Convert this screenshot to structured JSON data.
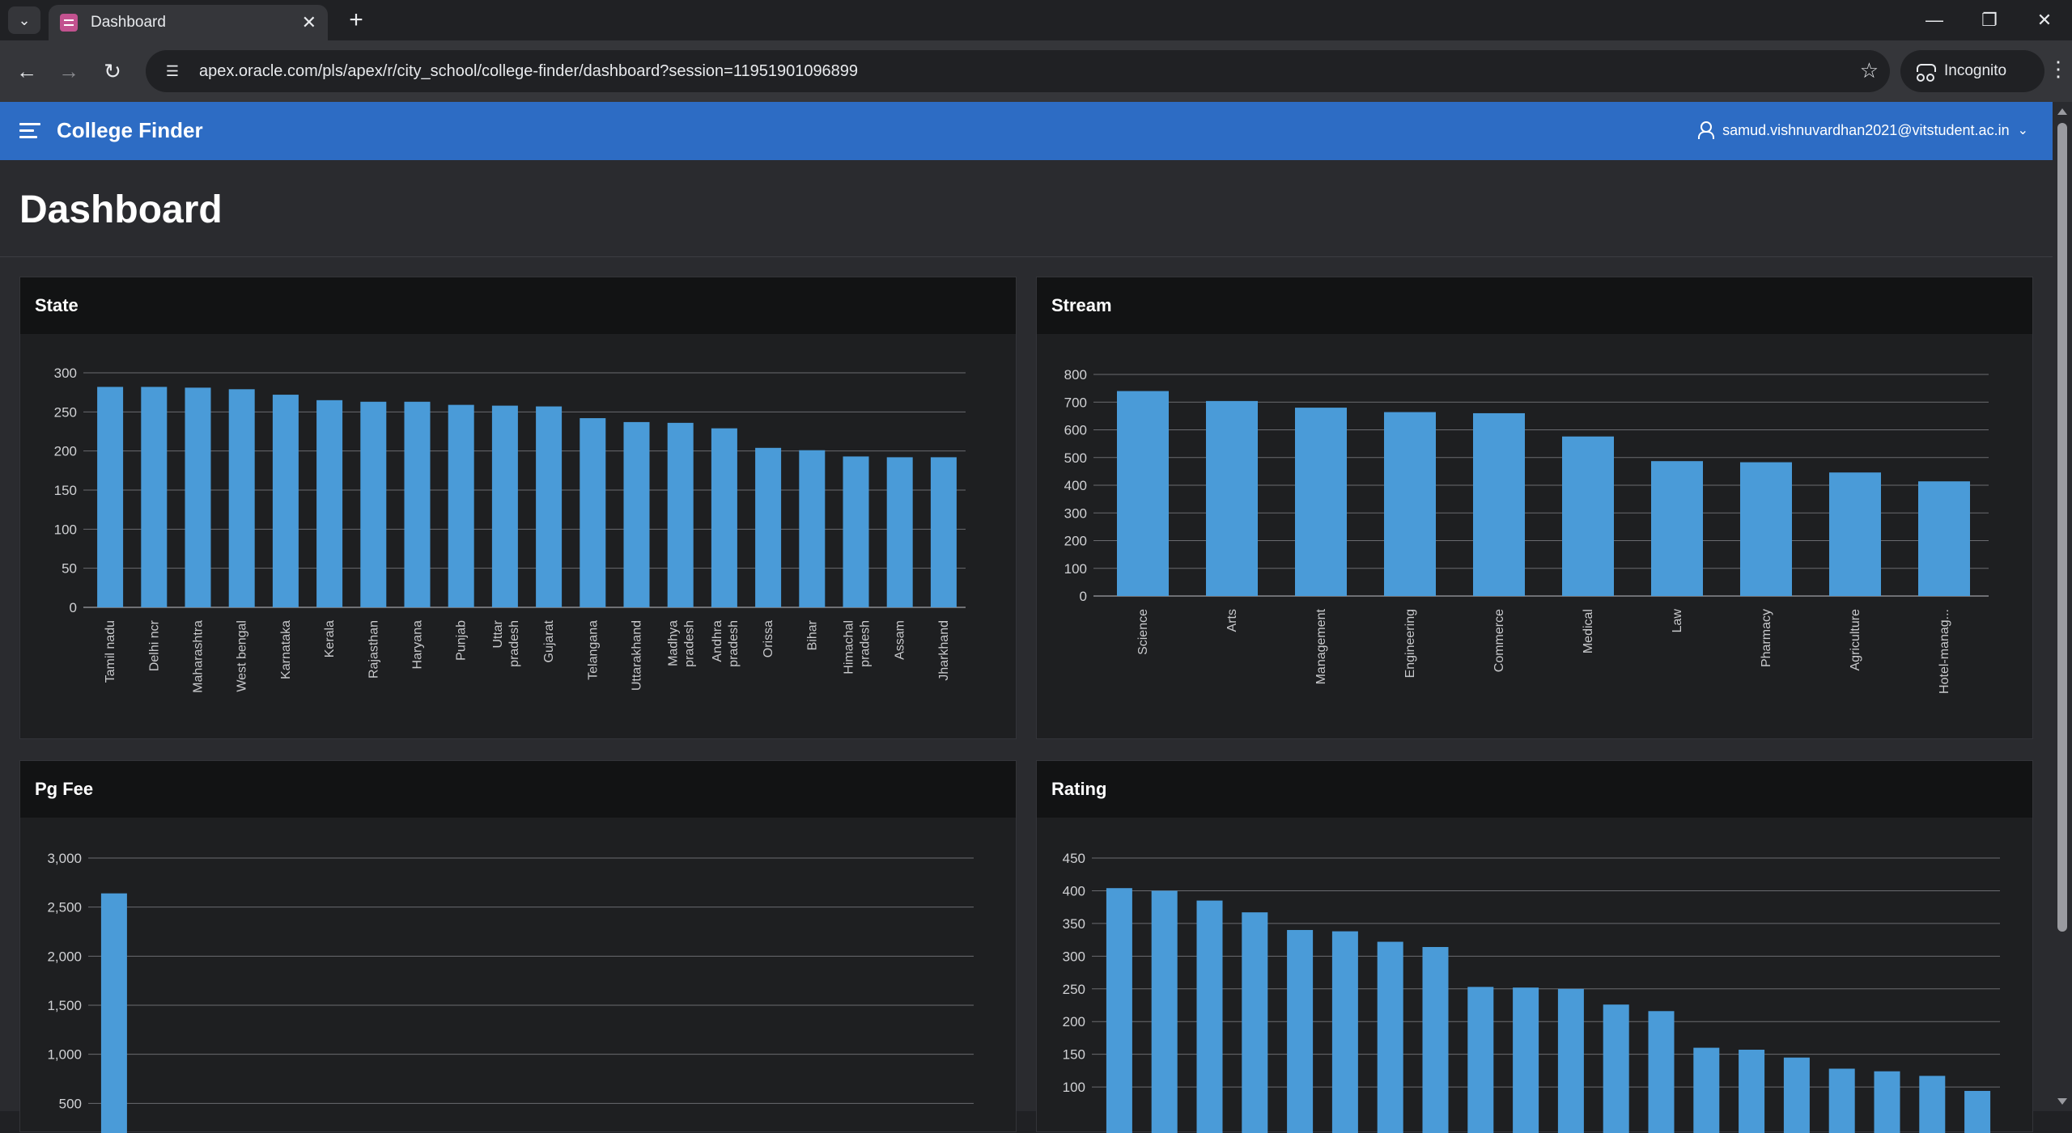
{
  "browser": {
    "tab_title": "Dashboard",
    "url": "apex.oracle.com/pls/apex/r/city_school/college-finder/dashboard?session=11951901096899",
    "incognito_label": "Incognito",
    "icons": [
      "tab-list-icon",
      "close-icon",
      "plus-icon",
      "minimize-icon",
      "restore-icon",
      "close-window-icon",
      "back-icon",
      "forward-icon",
      "reload-icon",
      "site-info-icon",
      "star-icon",
      "incognito-icon",
      "kebab-menu-icon"
    ]
  },
  "header": {
    "app_title": "College Finder",
    "user": "samud.vishnuvardhan2021@vitstudent.ac.in"
  },
  "page": {
    "title": "Dashboard"
  },
  "colors": {
    "bar": "#4a9bd8",
    "header": "#2d6cc4",
    "background": "#2a2b2f",
    "region": "#1e1f21"
  },
  "chart_data": [
    {
      "type": "bar",
      "title": "State",
      "categories": [
        "Tamil nadu",
        "Delhi ncr",
        "Maharashtra",
        "West bengal",
        "Karnataka",
        "Kerala",
        "Rajasthan",
        "Haryana",
        "Punjab",
        "Uttar pradesh",
        "Gujarat",
        "Telangana",
        "Uttarakhand",
        "Madhya pradesh",
        "Andhra pradesh",
        "Orissa",
        "Bihar",
        "Himachal pradesh",
        "Assam",
        "Jharkhand"
      ],
      "values": [
        282,
        282,
        281,
        279,
        272,
        265,
        263,
        263,
        259,
        258,
        257,
        242,
        237,
        236,
        229,
        204,
        201,
        193,
        192,
        192
      ],
      "ylim": [
        0,
        300
      ],
      "yticks": [
        "0",
        "50",
        "100",
        "150",
        "200",
        "250",
        "300"
      ]
    },
    {
      "type": "bar",
      "title": "Stream",
      "categories": [
        "Science",
        "Arts",
        "Management",
        "Engineering",
        "Commerce",
        "Medical",
        "Law",
        "Pharmacy",
        "Agriculture",
        "Hotel-manag..."
      ],
      "values": [
        740,
        704,
        680,
        664,
        660,
        576,
        487,
        483,
        446,
        414
      ],
      "ylim": [
        0,
        800
      ],
      "yticks": [
        "0",
        "100",
        "200",
        "300",
        "400",
        "500",
        "600",
        "700",
        "800"
      ]
    },
    {
      "type": "bar",
      "title": "Pg Fee",
      "categories": [
        ""
      ],
      "values": [
        2640
      ],
      "ylim": [
        0,
        3000
      ],
      "yticks": [
        "500",
        "1,000",
        "1,500",
        "2,000",
        "2,500",
        "3,000"
      ]
    },
    {
      "type": "bar",
      "title": "Rating",
      "values": [
        404,
        400,
        385,
        367,
        340,
        338,
        322,
        314,
        253,
        252,
        250,
        226,
        216,
        160,
        157,
        145,
        128,
        124,
        117,
        94
      ],
      "ylim": [
        0,
        450
      ],
      "yticks": [
        "100",
        "150",
        "200",
        "250",
        "300",
        "350",
        "400",
        "450"
      ]
    }
  ]
}
